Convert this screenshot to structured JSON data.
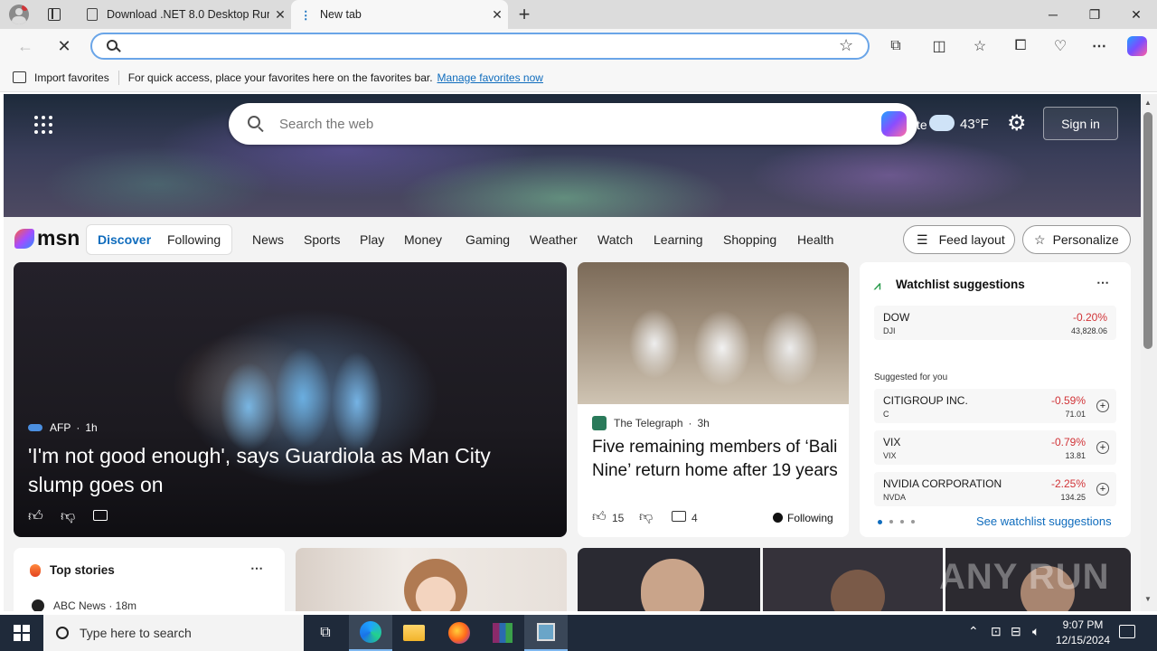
{
  "browser": {
    "tabs": [
      {
        "title": "Download .NET 8.0 Desktop Runt",
        "close": "✕"
      },
      {
        "title": "New tab",
        "close": "✕"
      }
    ],
    "new_tab": "+",
    "window": {
      "minimize": "─",
      "restore": "❐",
      "close": "✕"
    },
    "address_value": "",
    "favorites_bar": {
      "import": "Import favorites",
      "message": "For quick access, place your favorites here on the favorites bar.",
      "link": "Manage favorites now"
    }
  },
  "msn": {
    "search_placeholder": "Search the web",
    "weather_partial": "te",
    "temperature": "43°F",
    "sign_in": "Sign in",
    "logo": "msn",
    "tabs": [
      "Discover",
      "Following"
    ],
    "nav": [
      "News",
      "Sports",
      "Play",
      "Money",
      "Gaming",
      "Weather",
      "Watch",
      "Learning",
      "Shopping",
      "Health"
    ],
    "feed_layout": "Feed layout",
    "personalize": "Personalize",
    "lead_story": {
      "source": "AFP",
      "age": "1h",
      "headline": "'I'm not good enough', says Guardiola as Man City slump goes on"
    },
    "second_story": {
      "source": "The Telegraph",
      "age": "3h",
      "headline": "Five remaining members of ‘Bali Nine’ return home after 19 years",
      "likes": "15",
      "comments": "4",
      "following": "Following"
    },
    "watchlist": {
      "title": "Watchlist suggestions",
      "dow": {
        "name": "DOW",
        "symbol": "DJI",
        "change": "-0.20%",
        "price": "43,828.06"
      },
      "suggested_label": "Suggested for you",
      "stocks": [
        {
          "name": "CITIGROUP INC.",
          "symbol": "C",
          "change": "-0.59%",
          "price": "71.01"
        },
        {
          "name": "VIX",
          "symbol": "VIX",
          "change": "-0.79%",
          "price": "13.81"
        },
        {
          "name": "NVIDIA CORPORATION",
          "symbol": "NVDA",
          "change": "-2.25%",
          "price": "134.25"
        }
      ],
      "see_more": "See watchlist suggestions"
    },
    "top_stories": {
      "title": "Top stories",
      "first_source": "ABC News · 18m"
    },
    "watermark": "ANY RUN"
  },
  "taskbar": {
    "search_placeholder": "Type here to search",
    "time": "9:07 PM",
    "date": "12/15/2024"
  },
  "colors": {
    "accent": "#0f6cbd",
    "negative": "#d13438",
    "taskbar": "#1f2a3a"
  }
}
